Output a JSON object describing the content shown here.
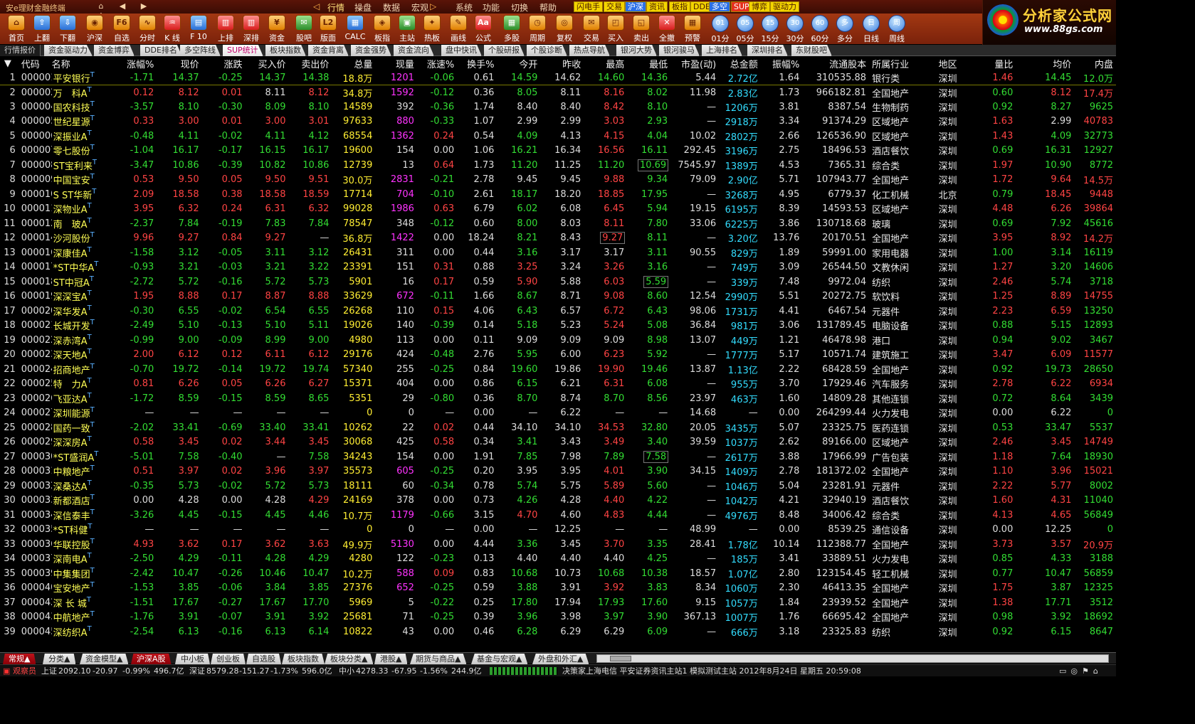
{
  "window": {
    "title": "安e理财金融终端"
  },
  "menu": [
    "行情",
    "操盘",
    "数据",
    "宏观",
    "系统",
    "功能",
    "切换",
    "帮助"
  ],
  "quick_buttons": [
    "闪电手",
    "交易",
    "沪深",
    "资讯",
    "板指",
    "DDE",
    "多空",
    "SUP",
    "博弈",
    "驱动力"
  ],
  "toolbar": [
    "首页",
    "上翻",
    "下翻",
    "沪深",
    "自选",
    "分时",
    "K 线",
    "F 10",
    "上排",
    "深排",
    "资金",
    "股吧",
    "版面",
    "CALC",
    "板指",
    "主站",
    "热板",
    "画线",
    "公式",
    "多股",
    "周期",
    "复权",
    "交易",
    "买入",
    "卖出",
    "全撤",
    "预警"
  ],
  "toolbar_icon_text": {
    "f6": "F6",
    "l2": "L2",
    "aa": "Aa"
  },
  "periods": [
    {
      "c": "01",
      "l": "01分"
    },
    {
      "c": "05",
      "l": "05分"
    },
    {
      "c": "15",
      "l": "15分"
    },
    {
      "c": "30",
      "l": "30分"
    },
    {
      "c": "60",
      "l": "60分"
    },
    {
      "c": "多",
      "l": "多分"
    },
    {
      "c": "日",
      "l": "日线"
    },
    {
      "c": "周",
      "l": "周线"
    }
  ],
  "logo": {
    "brand": "分析家公式网",
    "url": "www.88gs.com"
  },
  "tabs": [
    "行情报价",
    "资金驱动力",
    "资金博弈",
    "DDE排名",
    "多空阵线",
    "SUP统计",
    "板块指数",
    "资金背离",
    "资金强势",
    "资金流向",
    "盘中快讯",
    "个股研报",
    "个股诊断",
    "热点导航",
    "银河大势",
    "银河骏马",
    "上海排名",
    "深圳排名",
    "东财股吧"
  ],
  "columns": [
    "代码",
    "名称",
    "涨幅%",
    "现价",
    "涨跌",
    "买入价",
    "卖出价",
    "总量",
    "现量",
    "涨速%",
    "换手%",
    "今开",
    "昨收",
    "最高",
    "最低",
    "市盈(动)",
    "总金额",
    "振幅%",
    "流通股本",
    "所属行业",
    "地区",
    "量比",
    "均价",
    "内盘"
  ],
  "rows": [
    [
      "000001",
      "平安银行",
      "-1.71",
      "14.37",
      "-0.25",
      "14.37",
      "14.38",
      "18.8万",
      "1201",
      "-0.06",
      "0.61",
      "14.59",
      "14.62",
      "14.60",
      "14.36",
      "5.44",
      "2.72亿",
      "1.64",
      "310535.88",
      "银行类",
      "深圳",
      "1.46",
      "14.45",
      "12.0万"
    ],
    [
      "000002",
      "万　科A",
      "0.12",
      "8.12",
      "0.01",
      "8.11",
      "8.12",
      "34.8万",
      "1592",
      "-0.12",
      "0.36",
      "8.05",
      "8.11",
      "8.16",
      "8.02",
      "11.98",
      "2.83亿",
      "1.73",
      "966182.81",
      "全国地产",
      "深圳",
      "0.60",
      "8.12",
      "17.4万"
    ],
    [
      "000004",
      "国农科技",
      "-3.57",
      "8.10",
      "-0.30",
      "8.09",
      "8.10",
      "14589",
      "392",
      "-0.36",
      "1.74",
      "8.40",
      "8.40",
      "8.42",
      "8.10",
      "—",
      "1206万",
      "3.81",
      "8387.54",
      "生物制药",
      "深圳",
      "0.92",
      "8.27",
      "9625"
    ],
    [
      "000005",
      "世纪星源",
      "0.33",
      "3.00",
      "0.01",
      "3.00",
      "3.01",
      "97633",
      "880",
      "-0.33",
      "1.07",
      "2.99",
      "2.99",
      "3.03",
      "2.93",
      "—",
      "2918万",
      "3.34",
      "91374.29",
      "区域地产",
      "深圳",
      "1.63",
      "2.99",
      "40783"
    ],
    [
      "000006",
      "深振业A",
      "-0.48",
      "4.11",
      "-0.02",
      "4.11",
      "4.12",
      "68554",
      "1362",
      "0.24",
      "0.54",
      "4.09",
      "4.13",
      "4.15",
      "4.04",
      "10.02",
      "2802万",
      "2.66",
      "126536.90",
      "区域地产",
      "深圳",
      "1.43",
      "4.09",
      "32773"
    ],
    [
      "000007",
      "零七股份",
      "-1.04",
      "16.17",
      "-0.17",
      "16.15",
      "16.17",
      "19600",
      "154",
      "0.00",
      "1.06",
      "16.21",
      "16.34",
      "16.56",
      "16.11",
      "292.45",
      "3196万",
      "2.75",
      "18496.53",
      "酒店餐饮",
      "深圳",
      "0.69",
      "16.31",
      "12927"
    ],
    [
      "000008",
      "ST宝利来",
      "-3.47",
      "10.86",
      "-0.39",
      "10.82",
      "10.86",
      "12739",
      "13",
      "0.64",
      "1.73",
      "11.20",
      "11.25",
      "11.20",
      "10.69",
      "7545.97",
      "1389万",
      "4.53",
      "7365.31",
      "综合类",
      "深圳",
      "1.97",
      "10.90",
      "8772"
    ],
    [
      "000009",
      "中国宝安",
      "0.53",
      "9.50",
      "0.05",
      "9.50",
      "9.51",
      "30.0万",
      "2831",
      "-0.21",
      "2.78",
      "9.45",
      "9.45",
      "9.88",
      "9.34",
      "79.09",
      "2.90亿",
      "5.71",
      "107943.77",
      "全国地产",
      "深圳",
      "1.72",
      "9.64",
      "14.5万"
    ],
    [
      "000010",
      "S ST华新",
      "2.09",
      "18.58",
      "0.38",
      "18.58",
      "18.59",
      "17714",
      "704",
      "-0.10",
      "2.61",
      "18.17",
      "18.20",
      "18.85",
      "17.95",
      "—",
      "3268万",
      "4.95",
      "6779.37",
      "化工机械",
      "北京",
      "0.79",
      "18.45",
      "9448"
    ],
    [
      "000011",
      "深物业A",
      "3.95",
      "6.32",
      "0.24",
      "6.31",
      "6.32",
      "99028",
      "1986",
      "0.63",
      "6.79",
      "6.02",
      "6.08",
      "6.45",
      "5.94",
      "19.15",
      "6195万",
      "8.39",
      "14593.53",
      "区域地产",
      "深圳",
      "4.48",
      "6.26",
      "39864"
    ],
    [
      "000012",
      "南　玻A",
      "-2.37",
      "7.84",
      "-0.19",
      "7.83",
      "7.84",
      "78547",
      "348",
      "-0.12",
      "0.60",
      "8.00",
      "8.03",
      "8.11",
      "7.80",
      "33.06",
      "6225万",
      "3.86",
      "130718.68",
      "玻璃",
      "深圳",
      "0.69",
      "7.92",
      "45616"
    ],
    [
      "000014",
      "沙河股份",
      "9.96",
      "9.27",
      "0.84",
      "9.27",
      "—",
      "36.8万",
      "1422",
      "0.00",
      "18.24",
      "8.21",
      "8.43",
      "9.27",
      "8.11",
      "—",
      "3.20亿",
      "13.76",
      "20170.51",
      "全国地产",
      "深圳",
      "3.95",
      "8.92",
      "14.2万"
    ],
    [
      "000016",
      "深康佳A",
      "-1.58",
      "3.12",
      "-0.05",
      "3.11",
      "3.12",
      "26431",
      "311",
      "0.00",
      "0.44",
      "3.16",
      "3.17",
      "3.17",
      "3.11",
      "90.55",
      "829万",
      "1.89",
      "59991.00",
      "家用电器",
      "深圳",
      "1.00",
      "3.14",
      "16119"
    ],
    [
      "000017",
      "*ST中华A",
      "-0.93",
      "3.21",
      "-0.03",
      "3.21",
      "3.22",
      "23391",
      "151",
      "0.31",
      "0.88",
      "3.25",
      "3.24",
      "3.26",
      "3.16",
      "—",
      "749万",
      "3.09",
      "26544.50",
      "文教休闲",
      "深圳",
      "1.27",
      "3.20",
      "14606"
    ],
    [
      "000018",
      "ST中冠A",
      "-2.72",
      "5.72",
      "-0.16",
      "5.72",
      "5.73",
      "5901",
      "16",
      "0.17",
      "0.59",
      "5.90",
      "5.88",
      "6.03",
      "5.59",
      "—",
      "339万",
      "7.48",
      "9972.04",
      "纺织",
      "深圳",
      "2.46",
      "5.74",
      "3718"
    ],
    [
      "000019",
      "深深宝A",
      "1.95",
      "8.88",
      "0.17",
      "8.87",
      "8.88",
      "33629",
      "672",
      "-0.11",
      "1.66",
      "8.67",
      "8.71",
      "9.08",
      "8.60",
      "12.54",
      "2990万",
      "5.51",
      "20272.75",
      "软饮料",
      "深圳",
      "1.25",
      "8.89",
      "14755"
    ],
    [
      "000020",
      "深华发A",
      "-0.30",
      "6.55",
      "-0.02",
      "6.54",
      "6.55",
      "26268",
      "110",
      "0.15",
      "4.06",
      "6.43",
      "6.57",
      "6.72",
      "6.43",
      "98.06",
      "1731万",
      "4.41",
      "6467.54",
      "元器件",
      "深圳",
      "2.23",
      "6.59",
      "13250"
    ],
    [
      "000021",
      "长城开发",
      "-2.49",
      "5.10",
      "-0.13",
      "5.10",
      "5.11",
      "19026",
      "140",
      "-0.39",
      "0.14",
      "5.18",
      "5.23",
      "5.24",
      "5.08",
      "36.84",
      "981万",
      "3.06",
      "131789.45",
      "电脑设备",
      "深圳",
      "0.88",
      "5.15",
      "12893"
    ],
    [
      "000022",
      "深赤湾A",
      "-0.99",
      "9.00",
      "-0.09",
      "8.99",
      "9.00",
      "4980",
      "113",
      "0.00",
      "0.11",
      "9.09",
      "9.09",
      "9.09",
      "8.98",
      "13.07",
      "449万",
      "1.21",
      "46478.98",
      "港口",
      "深圳",
      "0.94",
      "9.02",
      "3467"
    ],
    [
      "000023",
      "深天地A",
      "2.00",
      "6.12",
      "0.12",
      "6.11",
      "6.12",
      "29176",
      "424",
      "-0.48",
      "2.76",
      "5.95",
      "6.00",
      "6.23",
      "5.92",
      "—",
      "1777万",
      "5.17",
      "10571.74",
      "建筑施工",
      "深圳",
      "3.47",
      "6.09",
      "11577"
    ],
    [
      "000024",
      "招商地产",
      "-0.70",
      "19.72",
      "-0.14",
      "19.72",
      "19.74",
      "57340",
      "255",
      "-0.25",
      "0.84",
      "19.60",
      "19.86",
      "19.90",
      "19.46",
      "13.87",
      "1.13亿",
      "2.22",
      "68428.59",
      "全国地产",
      "深圳",
      "0.92",
      "19.73",
      "28650"
    ],
    [
      "000025",
      "特　力A",
      "0.81",
      "6.26",
      "0.05",
      "6.26",
      "6.27",
      "15371",
      "404",
      "0.00",
      "0.86",
      "6.15",
      "6.21",
      "6.31",
      "6.08",
      "—",
      "955万",
      "3.70",
      "17929.46",
      "汽车服务",
      "深圳",
      "2.78",
      "6.22",
      "6934"
    ],
    [
      "000026",
      "飞亚达A",
      "-1.72",
      "8.59",
      "-0.15",
      "8.59",
      "8.65",
      "5351",
      "29",
      "-0.80",
      "0.36",
      "8.70",
      "8.74",
      "8.70",
      "8.56",
      "23.97",
      "463万",
      "1.60",
      "14809.28",
      "其他连锁",
      "深圳",
      "0.72",
      "8.64",
      "3439"
    ],
    [
      "000027",
      "深圳能源",
      "—",
      "—",
      "—",
      "—",
      "—",
      "0",
      "0",
      "—",
      "0.00",
      "—",
      "6.22",
      "—",
      "—",
      "14.68",
      "—",
      "0.00",
      "264299.44",
      "火力发电",
      "深圳",
      "0.00",
      "6.22",
      "0"
    ],
    [
      "000028",
      "国药一致",
      "-2.02",
      "33.41",
      "-0.69",
      "33.40",
      "33.41",
      "10262",
      "22",
      "0.02",
      "0.44",
      "34.10",
      "34.10",
      "34.53",
      "32.80",
      "20.05",
      "3435万",
      "5.07",
      "23325.75",
      "医药连锁",
      "深圳",
      "0.53",
      "33.47",
      "5537"
    ],
    [
      "000029",
      "深深房A",
      "0.58",
      "3.45",
      "0.02",
      "3.44",
      "3.45",
      "30068",
      "425",
      "0.58",
      "0.34",
      "3.41",
      "3.43",
      "3.49",
      "3.40",
      "39.59",
      "1037万",
      "2.62",
      "89166.00",
      "区域地产",
      "深圳",
      "2.46",
      "3.45",
      "14749"
    ],
    [
      "000030",
      "*ST盛润A",
      "-5.01",
      "7.58",
      "-0.40",
      "—",
      "7.58",
      "34243",
      "154",
      "0.00",
      "1.91",
      "7.85",
      "7.98",
      "7.89",
      "7.58",
      "—",
      "2617万",
      "3.88",
      "17966.99",
      "广告包装",
      "深圳",
      "1.18",
      "7.64",
      "18930"
    ],
    [
      "000031",
      "中粮地产",
      "0.51",
      "3.97",
      "0.02",
      "3.96",
      "3.97",
      "35573",
      "605",
      "-0.25",
      "0.20",
      "3.95",
      "3.95",
      "4.01",
      "3.90",
      "34.15",
      "1409万",
      "2.78",
      "181372.02",
      "全国地产",
      "深圳",
      "1.10",
      "3.96",
      "15021"
    ],
    [
      "000032",
      "深桑达A",
      "-0.35",
      "5.73",
      "-0.02",
      "5.72",
      "5.73",
      "18111",
      "60",
      "-0.34",
      "0.78",
      "5.74",
      "5.75",
      "5.89",
      "5.60",
      "—",
      "1046万",
      "5.04",
      "23281.91",
      "元器件",
      "深圳",
      "2.22",
      "5.77",
      "8002"
    ],
    [
      "000033",
      "新都酒店",
      "0.00",
      "4.28",
      "0.00",
      "4.28",
      "4.29",
      "24169",
      "378",
      "0.00",
      "0.73",
      "4.26",
      "4.28",
      "4.40",
      "4.22",
      "—",
      "1042万",
      "4.21",
      "32940.19",
      "酒店餐饮",
      "深圳",
      "1.60",
      "4.31",
      "11040"
    ],
    [
      "000034",
      "深信泰丰",
      "-3.26",
      "4.45",
      "-0.15",
      "4.45",
      "4.46",
      "10.7万",
      "1179",
      "-0.66",
      "3.15",
      "4.70",
      "4.60",
      "4.83",
      "4.44",
      "—",
      "4976万",
      "8.48",
      "34006.42",
      "综合类",
      "深圳",
      "4.13",
      "4.65",
      "56849"
    ],
    [
      "000035",
      "*ST科健",
      "—",
      "—",
      "—",
      "—",
      "—",
      "0",
      "0",
      "—",
      "0.00",
      "—",
      "12.25",
      "—",
      "—",
      "48.99",
      "—",
      "0.00",
      "8539.25",
      "通信设备",
      "深圳",
      "0.00",
      "12.25",
      "0"
    ],
    [
      "000036",
      "华联控股",
      "4.93",
      "3.62",
      "0.17",
      "3.62",
      "3.63",
      "49.9万",
      "5130",
      "0.00",
      "4.44",
      "3.36",
      "3.45",
      "3.70",
      "3.35",
      "28.41",
      "1.78亿",
      "10.14",
      "112388.77",
      "全国地产",
      "深圳",
      "3.73",
      "3.57",
      "20.9万"
    ],
    [
      "000037",
      "深南电A",
      "-2.50",
      "4.29",
      "-0.11",
      "4.28",
      "4.29",
      "4280",
      "122",
      "-0.23",
      "0.13",
      "4.40",
      "4.40",
      "4.40",
      "4.25",
      "—",
      "185万",
      "3.41",
      "33889.51",
      "火力发电",
      "深圳",
      "0.85",
      "4.33",
      "3188"
    ],
    [
      "000039",
      "中集集团",
      "-2.42",
      "10.47",
      "-0.26",
      "10.46",
      "10.47",
      "10.2万",
      "588",
      "0.09",
      "0.83",
      "10.68",
      "10.73",
      "10.68",
      "10.38",
      "18.57",
      "1.07亿",
      "2.80",
      "123154.45",
      "轻工机械",
      "深圳",
      "0.77",
      "10.47",
      "56859"
    ],
    [
      "000040",
      "宝安地产",
      "-1.53",
      "3.85",
      "-0.06",
      "3.84",
      "3.85",
      "27376",
      "652",
      "-0.25",
      "0.59",
      "3.88",
      "3.91",
      "3.92",
      "3.83",
      "8.34",
      "1060万",
      "2.30",
      "46413.35",
      "全国地产",
      "深圳",
      "1.75",
      "3.87",
      "12325"
    ],
    [
      "000042",
      "深 长 城",
      "-1.51",
      "17.67",
      "-0.27",
      "17.67",
      "17.70",
      "5969",
      "5",
      "-0.22",
      "0.25",
      "17.80",
      "17.94",
      "17.93",
      "17.60",
      "9.15",
      "1057万",
      "1.84",
      "23939.52",
      "全国地产",
      "深圳",
      "1.38",
      "17.71",
      "3512"
    ],
    [
      "000043",
      "中航地产",
      "-1.76",
      "3.91",
      "-0.07",
      "3.91",
      "3.92",
      "25681",
      "71",
      "-0.25",
      "0.39",
      "3.96",
      "3.98",
      "3.97",
      "3.90",
      "367.13",
      "1007万",
      "1.76",
      "66695.42",
      "全国地产",
      "深圳",
      "0.98",
      "3.92",
      "18692"
    ],
    [
      "000045",
      "深纺织A",
      "-2.54",
      "6.13",
      "-0.16",
      "6.13",
      "6.14",
      "10822",
      "43",
      "0.00",
      "0.46",
      "6.28",
      "6.29",
      "6.29",
      "6.09",
      "—",
      "666万",
      "3.18",
      "23325.83",
      "纺织",
      "深圳",
      "0.92",
      "6.15",
      "8647"
    ]
  ],
  "bottom_tabs": [
    "常规▲",
    "分类▲",
    "资金模型▲",
    "沪深A股",
    "中小板",
    "创业板",
    "自选股",
    "板块指数",
    "板块分类▲",
    "港股▲",
    "期货与商品▲",
    "基金与宏观▲",
    "外盘和外汇▲"
  ],
  "status": {
    "user": "观察员",
    "sh_label": "上证",
    "sh": "2092.10",
    "sh_chg": "-20.97",
    "sh_pct": "-0.99%",
    "sh_amt": "496.7亿",
    "sz_label": "深证",
    "sz": "8579.28",
    "sz_chg": "-151.27",
    "sz_pct": "-1.73%",
    "sz_amt": "596.0亿",
    "zx_label": "中小",
    "zx": "4278.33",
    "zx_chg": "-67.95",
    "zx_pct": "-1.56%",
    "zx_amt": "244.9亿",
    "info": "决策家上海电信 平安证券资讯主站1 模拟测试主站 2012年8月24日 星期五 20:59:08"
  }
}
